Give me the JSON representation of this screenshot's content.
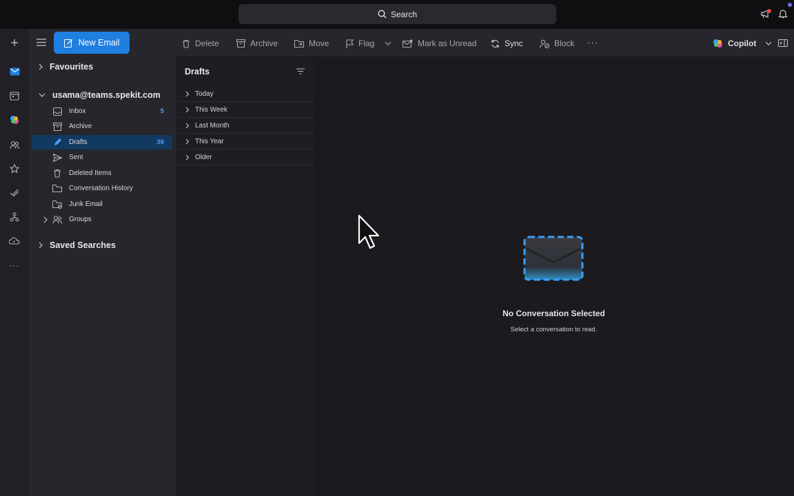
{
  "titlebar": {
    "search_label": "Search"
  },
  "toolbar": {
    "new_email": "New Email",
    "delete": "Delete",
    "archive": "Archive",
    "move": "Move",
    "flag": "Flag",
    "mark_unread": "Mark as Unread",
    "sync": "Sync",
    "block": "Block",
    "copilot": "Copilot"
  },
  "folders": {
    "favourites": "Favourites",
    "account": "usama@teams.spekit.com",
    "items": [
      {
        "label": "Inbox",
        "count": "5",
        "icon": "inbox-icon"
      },
      {
        "label": "Archive",
        "count": "",
        "icon": "archive-box-icon"
      },
      {
        "label": "Drafts",
        "count": "36",
        "icon": "pencil-icon"
      },
      {
        "label": "Sent",
        "count": "",
        "icon": "send-icon"
      },
      {
        "label": "Deleted Items",
        "count": "",
        "icon": "trash-icon"
      },
      {
        "label": "Conversation History",
        "count": "",
        "icon": "folder-icon"
      },
      {
        "label": "Junk Email",
        "count": "",
        "icon": "junk-folder-icon"
      },
      {
        "label": "Groups",
        "count": "",
        "icon": "people-icon"
      }
    ],
    "saved_searches": "Saved Searches"
  },
  "message_list": {
    "title": "Drafts",
    "groups": [
      "Today",
      "This Week",
      "Last Month",
      "This Year",
      "Older"
    ]
  },
  "reading_pane": {
    "empty_title": "No Conversation Selected",
    "empty_subtitle": "Select a conversation to read."
  },
  "colors": {
    "accent": "#1f7fe0",
    "selection": "#123a60",
    "count": "#4aa3ff",
    "notification": "#e5484d"
  }
}
